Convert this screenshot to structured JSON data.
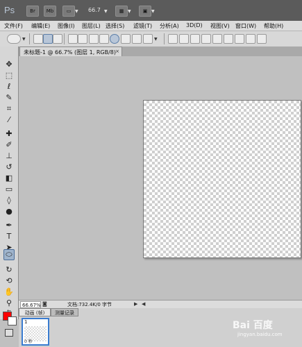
{
  "app_bar": {
    "logo": "Ps",
    "bridge_label": "Br",
    "mini_bridge_label": "Mb",
    "zoom_level": "66.7"
  },
  "menu": [
    "文件(F)",
    "编辑(E)",
    "图像(I)",
    "图层(L)",
    "选择(S)",
    "滤镜(T)",
    "分析(A)",
    "3D(D)",
    "视图(V)",
    "窗口(W)",
    "帮助(H)"
  ],
  "document_tab": {
    "label": "未标题-1 @ 66.7% (图层 1, RGB/8)",
    "close": "×"
  },
  "status_bar": {
    "zoom": "66.67%",
    "doc_info": "文档:732.4K/0 字节"
  },
  "panels": {
    "animation_tab": "动画 (帧)",
    "history_tab": "测量记录"
  },
  "frame": {
    "number": "1",
    "delay": "0 秒"
  },
  "watermark": {
    "logo": "Bai 百度",
    "sub": "jingyan.baidu.com"
  },
  "colors": {
    "foreground": "#ff0000",
    "background": "#ffffff"
  }
}
